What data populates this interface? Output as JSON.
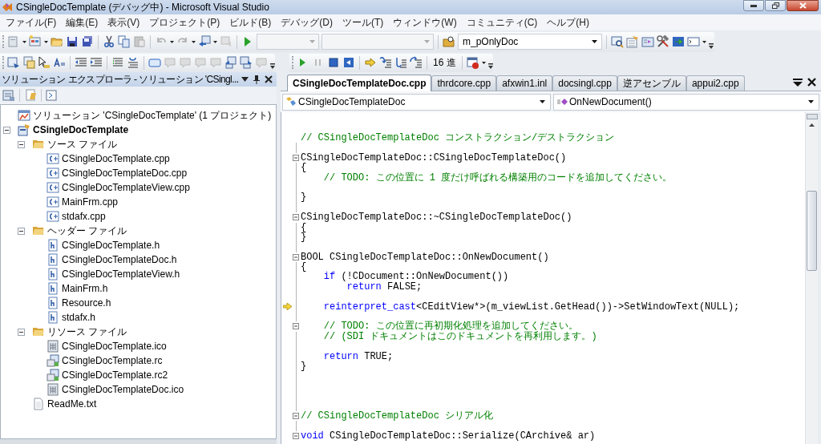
{
  "window": {
    "title": "CSingleDocTemplate (デバッグ中) - Microsoft Visual Studio"
  },
  "menu": [
    "ファイル(F)",
    "編集(E)",
    "表示(V)",
    "プロジェクト(P)",
    "ビルド(B)",
    "デバッグ(D)",
    "ツール(T)",
    "ウィンドウ(W)",
    "コミュニティ(C)",
    "ヘルプ(H)"
  ],
  "toolbar": {
    "find_combo": {
      "value": "m_pOnlyDoc"
    },
    "hex_button": {
      "label": "16 進"
    }
  },
  "solution_explorer": {
    "title": "ソリューション エクスプローラ - ソリューション 'CSingl...",
    "tree": [
      {
        "label": "ソリューション 'CSingleDocTemplate' (1 プロジェクト)",
        "kind": "solution"
      },
      {
        "label": "CSingleDocTemplate",
        "kind": "project",
        "expanded": true,
        "children": [
          {
            "label": "ソース ファイル",
            "kind": "folder",
            "expanded": true,
            "children": [
              {
                "label": "CSingleDocTemplate.cpp",
                "kind": "cpp"
              },
              {
                "label": "CSingleDocTemplateDoc.cpp",
                "kind": "cpp"
              },
              {
                "label": "CSingleDocTemplateView.cpp",
                "kind": "cpp"
              },
              {
                "label": "MainFrm.cpp",
                "kind": "cpp"
              },
              {
                "label": "stdafx.cpp",
                "kind": "cpp"
              }
            ]
          },
          {
            "label": "ヘッダー ファイル",
            "kind": "folder",
            "expanded": true,
            "children": [
              {
                "label": "CSingleDocTemplate.h",
                "kind": "h"
              },
              {
                "label": "CSingleDocTemplateDoc.h",
                "kind": "h"
              },
              {
                "label": "CSingleDocTemplateView.h",
                "kind": "h"
              },
              {
                "label": "MainFrm.h",
                "kind": "h"
              },
              {
                "label": "Resource.h",
                "kind": "h"
              },
              {
                "label": "stdafx.h",
                "kind": "h"
              }
            ]
          },
          {
            "label": "リソース ファイル",
            "kind": "folder",
            "expanded": true,
            "children": [
              {
                "label": "CSingleDocTemplate.ico",
                "kind": "ico"
              },
              {
                "label": "CSingleDocTemplate.rc",
                "kind": "rc"
              },
              {
                "label": "CSingleDocTemplate.rc2",
                "kind": "rc"
              },
              {
                "label": "CSingleDocTemplateDoc.ico",
                "kind": "ico"
              }
            ]
          },
          {
            "label": "ReadMe.txt",
            "kind": "txt"
          }
        ]
      }
    ]
  },
  "editor": {
    "tabs": [
      {
        "label": "CSingleDocTemplateDoc.cpp",
        "selected": true
      },
      {
        "label": "thrdcore.cpp",
        "selected": false
      },
      {
        "label": "afxwin1.inl",
        "selected": false
      },
      {
        "label": "docsingl.cpp",
        "selected": false
      },
      {
        "label": "逆アセンブル",
        "selected": false
      },
      {
        "label": "appui2.cpp",
        "selected": false
      }
    ],
    "class_combo": {
      "value": "CSingleDocTemplateDoc"
    },
    "member_combo": {
      "value": "OnNewDocument()"
    },
    "lines": [
      {
        "kind": "code",
        "collapsible": false,
        "current": false,
        "segments": [
          {
            "kind": "comment",
            "text": "// CSingleDocTemplateDoc コンストラクション/デストラクション"
          }
        ]
      },
      {
        "kind": "blank",
        "collapsible": false,
        "current": false
      },
      {
        "kind": "code",
        "collapsible": true,
        "current": false,
        "segments": [
          {
            "kind": "plain",
            "text": "CSingleDocTemplateDoc::CSingleDocTemplateDoc()"
          }
        ]
      },
      {
        "kind": "code",
        "collapsible": false,
        "current": false,
        "segments": [
          {
            "kind": "plain",
            "text": "{"
          }
        ]
      },
      {
        "kind": "code",
        "collapsible": false,
        "current": false,
        "segments": [
          {
            "kind": "comment",
            "text": "    // TODO: この位置に 1 度だけ呼ばれる構築用のコードを追加してください。"
          }
        ]
      },
      {
        "kind": "blank",
        "collapsible": false,
        "current": false
      },
      {
        "kind": "code",
        "collapsible": false,
        "current": false,
        "segments": [
          {
            "kind": "plain",
            "text": "}"
          }
        ]
      },
      {
        "kind": "blank",
        "collapsible": false,
        "current": false
      },
      {
        "kind": "code",
        "collapsible": true,
        "current": false,
        "segments": [
          {
            "kind": "plain",
            "text": "CSingleDocTemplateDoc::~CSingleDocTemplateDoc()"
          }
        ]
      },
      {
        "kind": "code",
        "collapsible": false,
        "current": false,
        "segments": [
          {
            "kind": "plain",
            "text": "{"
          }
        ]
      },
      {
        "kind": "code",
        "collapsible": false,
        "current": false,
        "segments": [
          {
            "kind": "plain",
            "text": "}"
          }
        ]
      },
      {
        "kind": "blank",
        "collapsible": false,
        "current": false
      },
      {
        "kind": "code",
        "collapsible": true,
        "current": false,
        "segments": [
          {
            "kind": "plain",
            "text": "BOOL CSingleDocTemplateDoc::OnNewDocument()"
          }
        ]
      },
      {
        "kind": "code",
        "collapsible": false,
        "current": false,
        "segments": [
          {
            "kind": "plain",
            "text": "{"
          }
        ]
      },
      {
        "kind": "code",
        "collapsible": false,
        "current": false,
        "segments": [
          {
            "kind": "keyword",
            "text": "    if"
          },
          {
            "kind": "plain",
            "text": " (!CDocument::OnNewDocument())"
          }
        ]
      },
      {
        "kind": "code",
        "collapsible": false,
        "current": false,
        "segments": [
          {
            "kind": "keyword",
            "text": "        return"
          },
          {
            "kind": "plain",
            "text": " FALSE;"
          }
        ]
      },
      {
        "kind": "blank",
        "collapsible": false,
        "current": false
      },
      {
        "kind": "code",
        "collapsible": false,
        "current": true,
        "segments": [
          {
            "kind": "keyword",
            "text": "    reinterpret_cast"
          },
          {
            "kind": "plain",
            "text": "<CEditView*>(m_viewList.GetHead())->SetWindowText(NULL);"
          }
        ]
      },
      {
        "kind": "blank",
        "collapsible": false,
        "current": false
      },
      {
        "kind": "code",
        "collapsible": true,
        "current": false,
        "segments": [
          {
            "kind": "comment",
            "text": "    // TODO: この位置に再初期化処理を追加してください。"
          }
        ]
      },
      {
        "kind": "code",
        "collapsible": false,
        "current": false,
        "segments": [
          {
            "kind": "comment",
            "text": "    // (SDI ドキュメントはこのドキュメントを再利用します。)"
          }
        ]
      },
      {
        "kind": "blank",
        "collapsible": false,
        "current": false
      },
      {
        "kind": "code",
        "collapsible": false,
        "current": false,
        "segments": [
          {
            "kind": "keyword",
            "text": "    return"
          },
          {
            "kind": "plain",
            "text": " TRUE;"
          }
        ]
      },
      {
        "kind": "code",
        "collapsible": false,
        "current": false,
        "segments": [
          {
            "kind": "plain",
            "text": "}"
          }
        ]
      },
      {
        "kind": "blank",
        "collapsible": false,
        "current": false
      },
      {
        "kind": "blank",
        "collapsible": false,
        "current": false
      },
      {
        "kind": "blank",
        "collapsible": false,
        "current": false
      },
      {
        "kind": "blank",
        "collapsible": false,
        "current": false
      },
      {
        "kind": "code",
        "collapsible": true,
        "current": false,
        "segments": [
          {
            "kind": "comment",
            "text": "// CSingleDocTemplateDoc シリアル化"
          }
        ]
      },
      {
        "kind": "blank",
        "collapsible": false,
        "current": false
      },
      {
        "kind": "code",
        "collapsible": true,
        "current": false,
        "segments": [
          {
            "kind": "keyword",
            "text": "void"
          },
          {
            "kind": "plain",
            "text": " CSingleDocTemplateDoc::Serialize(CArchive& ar)"
          }
        ]
      }
    ]
  }
}
